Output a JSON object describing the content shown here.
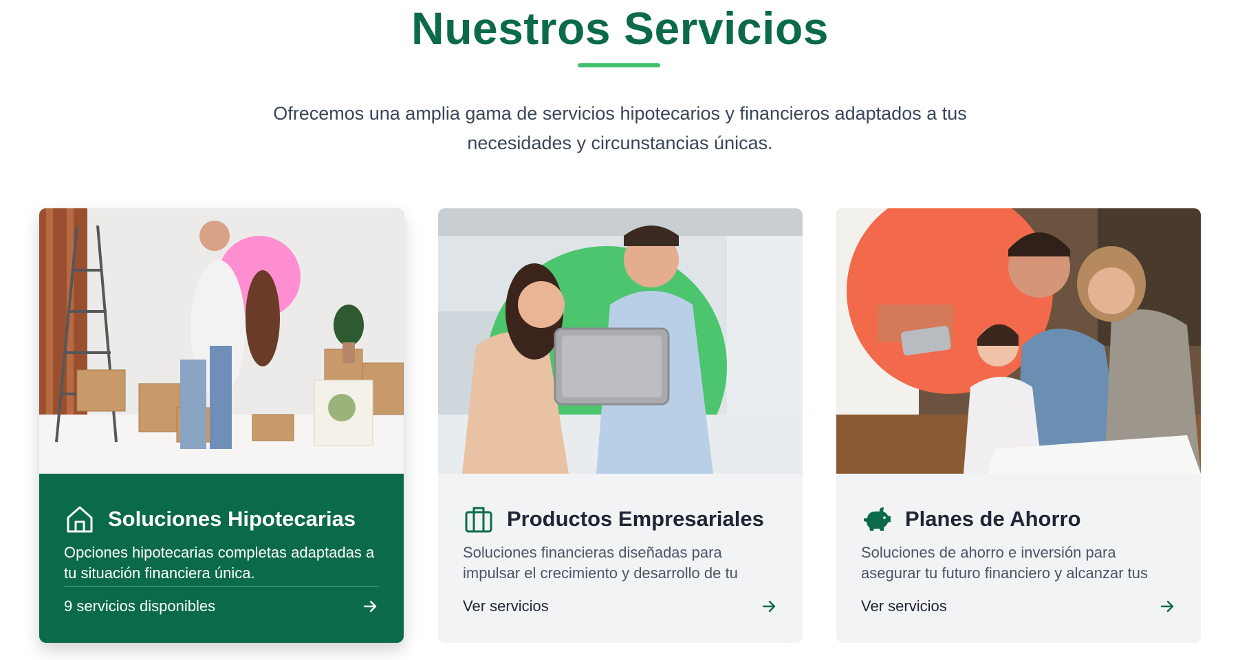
{
  "header": {
    "title": "Nuestros Servicios",
    "subtitle_line1": "Ofrecemos una amplia gama de servicios hipotecarios y financieros adaptados a tus",
    "subtitle_line2": "necesidades y circunstancias únicas."
  },
  "colors": {
    "brand_green": "#0b6b49",
    "accent_green": "#3fbf6a",
    "card_bg": "#f1f3f5",
    "text_dark": "#1e2533"
  },
  "cards": [
    {
      "title": "Soluciones Hipotecarias",
      "icon": "home-icon",
      "description": "Opciones hipotecarias completas adaptadas a tu situación financiera única.",
      "footer_label": "9 servicios disponibles",
      "arrow_icon": "arrow-right-icon",
      "image_accent_color": "#ff8fd0",
      "active": true
    },
    {
      "title": "Productos Empresariales",
      "icon": "briefcase-icon",
      "description": "Soluciones financieras diseñadas para impulsar el crecimiento y desarrollo de tu",
      "footer_label": "Ver servicios",
      "arrow_icon": "arrow-right-icon",
      "image_accent_color": "#4cc56e",
      "active": false
    },
    {
      "title": "Planes de Ahorro",
      "icon": "piggy-bank-icon",
      "description": "Soluciones de ahorro e inversión para asegurar tu futuro financiero y alcanzar tus",
      "footer_label": "Ver servicios",
      "arrow_icon": "arrow-right-icon",
      "image_accent_color": "#f26a4b",
      "active": false
    }
  ]
}
